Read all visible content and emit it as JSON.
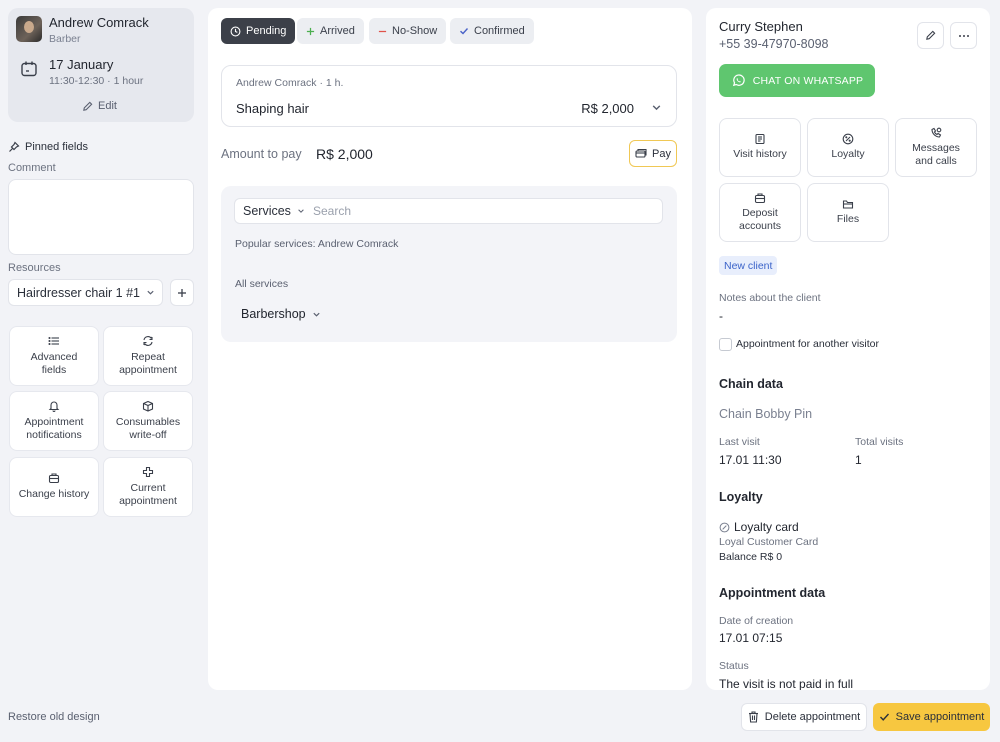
{
  "staff": {
    "name": "Andrew Comrack",
    "role": "Barber",
    "date": "17 January",
    "time": "11:30-12:30 · 1 hour",
    "edit_label": "Edit"
  },
  "left": {
    "pinned_label": "Pinned fields",
    "comment_label": "Comment",
    "comment_value": "",
    "resources_label": "Resources",
    "resource_value": "Hairdresser chair 1 #1",
    "tiles": [
      {
        "label": "Advanced fields",
        "icon": "list-icon"
      },
      {
        "label": "Repeat appointment",
        "icon": "repeat-icon"
      },
      {
        "label": "Appointment notifications",
        "icon": "bell-icon"
      },
      {
        "label": "Consumables write-off",
        "icon": "box-icon"
      },
      {
        "label": "Change history",
        "icon": "briefcase-icon"
      },
      {
        "label": "Current appointment",
        "icon": "plus-outline-icon"
      }
    ],
    "restore_label": "Restore old design"
  },
  "statuses": [
    {
      "label": "Pending",
      "icon": "clock-icon",
      "active": true
    },
    {
      "label": "Arrived",
      "icon": "plus-icon",
      "active": false
    },
    {
      "label": "No-Show",
      "icon": "minus-icon",
      "active": false
    },
    {
      "label": "Confirmed",
      "icon": "check-icon",
      "active": false
    }
  ],
  "service": {
    "meta": "Andrew Comrack · 1 h.",
    "name": "Shaping hair",
    "price": "R$ 2,000"
  },
  "payment": {
    "amount_label": "Amount to pay",
    "amount_value": "R$ 2,000",
    "pay_label": "Pay"
  },
  "services_panel": {
    "dropdown_label": "Services",
    "search_placeholder": "Search",
    "popular_label": "Popular services: Andrew Comrack",
    "all_label": "All services",
    "category": "Barbershop"
  },
  "client": {
    "name": "Curry Stephen",
    "phone": "+55 39-47970-8098",
    "whatsapp_label": "CHAT ON WHATSAPP",
    "tiles": [
      {
        "label": "Visit history",
        "icon": "document-icon"
      },
      {
        "label": "Loyalty",
        "icon": "percent-icon"
      },
      {
        "label": "Messages and calls",
        "icon": "phone-icon"
      },
      {
        "label": "Deposit accounts",
        "icon": "wallet-icon"
      },
      {
        "label": "Files",
        "icon": "folder-icon"
      }
    ],
    "badge": "New client",
    "notes_label": "Notes about the client",
    "notes_value": "-",
    "another_visitor_label": "Appointment for another visitor",
    "chain_heading": "Chain data",
    "chain_name": "Chain Bobby Pin",
    "last_visit_label": "Last visit",
    "last_visit_value": "17.01 11:30",
    "total_visits_label": "Total visits",
    "total_visits_value": "1",
    "loyalty_heading": "Loyalty",
    "loyalty_card_title": "Loyalty card",
    "loyalty_card_name": "Loyal Customer Card",
    "loyalty_balance": "Balance R$ 0",
    "appt_heading": "Appointment data",
    "creation_label": "Date of creation",
    "creation_value": "17.01 07:15",
    "status_label": "Status",
    "status_value": "The visit is not paid in full"
  },
  "actions": {
    "delete_label": "Delete appointment",
    "save_label": "Save appointment"
  },
  "colors": {
    "whatsapp": "#5fc66f",
    "save": "#f7c740",
    "active_status": "#3c4049",
    "badge_bg": "#e8eefc",
    "badge_text": "#3b63c9"
  }
}
